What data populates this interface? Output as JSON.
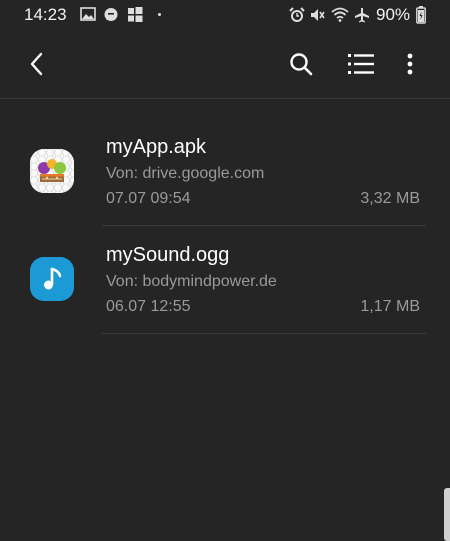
{
  "status_bar": {
    "time": "14:23",
    "battery": "90%",
    "icons": [
      "gallery-icon",
      "chat-icon",
      "windows-icon",
      "alarm-icon",
      "mute-icon",
      "wifi-icon",
      "airplane-icon",
      "battery-icon"
    ]
  },
  "toolbar": {
    "back": "back-icon",
    "search": "search-icon",
    "list_view": "list-view-icon",
    "more": "more-options-icon"
  },
  "files": [
    {
      "name": "myApp.apk",
      "source": "Von: drive.google.com",
      "date": "07.07 09:54",
      "size": "3,32 MB",
      "icon": "apk-package-icon"
    },
    {
      "name": "mySound.ogg",
      "source": "Von: bodymindpower.de",
      "date": "06.07 12:55",
      "size": "1,17 MB",
      "icon": "audio-file-icon",
      "icon_color": "#1c9ad6"
    }
  ]
}
